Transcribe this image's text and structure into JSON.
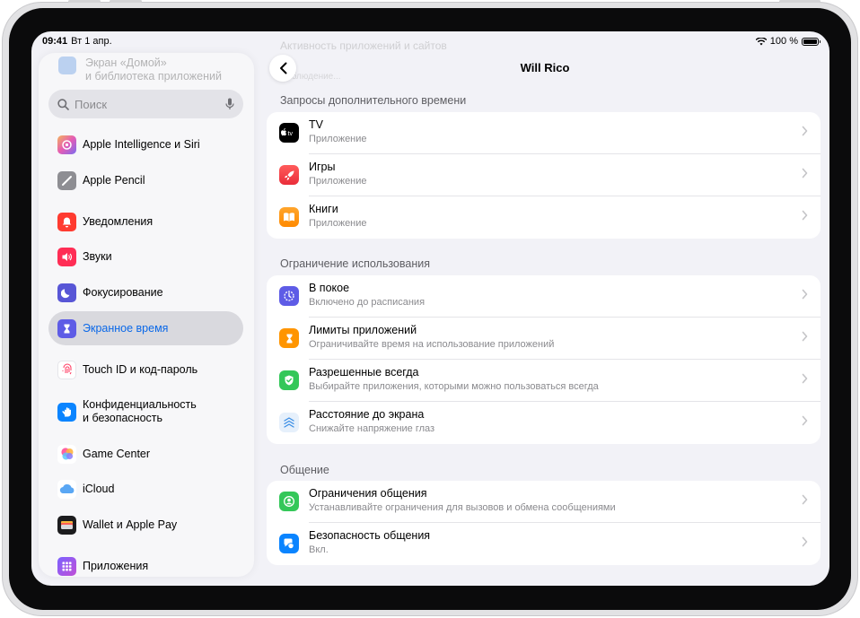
{
  "status_bar": {
    "time": "09:41",
    "date": "Вт 1 апр.",
    "battery": "100 %"
  },
  "sidebar": {
    "faded_item": "Экран «Домой»\nи библиотека приложений",
    "search_placeholder": "Поиск",
    "items": [
      {
        "label": "Apple Intelligence и Siri",
        "icon": "apple-intelligence-icon",
        "color": "#f0a85e"
      },
      {
        "label": "Apple Pencil",
        "icon": "apple-pencil-icon",
        "color": "#8e8e93"
      },
      {
        "label": "Уведомления",
        "icon": "bell-icon",
        "color": "#ff3b30"
      },
      {
        "label": "Звуки",
        "icon": "speaker-icon",
        "color": "#ff2d55"
      },
      {
        "label": "Фокусирование",
        "icon": "moon-icon",
        "color": "#5856d6"
      },
      {
        "label": "Экранное время",
        "icon": "hourglass-icon",
        "color": "#5e5ce6"
      },
      {
        "label": "Touch ID и код-пароль",
        "icon": "fingerprint-icon",
        "color": "#ffffff"
      },
      {
        "label": "Конфиденциальность\nи безопасность",
        "icon": "hand-icon",
        "color": "#0a84ff"
      },
      {
        "label": "Game Center",
        "icon": "game-center-icon",
        "color": "#ffffff"
      },
      {
        "label": "iCloud",
        "icon": "cloud-icon",
        "color": "#ffffff"
      },
      {
        "label": "Wallet и Apple Pay",
        "icon": "wallet-icon",
        "color": "#1c1c1e"
      },
      {
        "label": "Приложения",
        "icon": "apps-grid-icon",
        "color": "#5e5ce6"
      }
    ],
    "active_index": 5
  },
  "main": {
    "ghost_title": "Активность приложений и сайтов",
    "ghost_sub": "Наблюдение...",
    "nav_title": "Will Rico",
    "sections": [
      {
        "header": "Запросы дополнительного времени",
        "rows": [
          {
            "title": "TV",
            "subtitle": "Приложение",
            "icon": "apple-tv-icon",
            "color": "#000000"
          },
          {
            "title": "Игры",
            "subtitle": "Приложение",
            "icon": "games-rocket-icon",
            "color": "#ff3b30"
          },
          {
            "title": "Книги",
            "subtitle": "Приложение",
            "icon": "books-icon",
            "color": "#ff9500"
          }
        ]
      },
      {
        "header": "Ограничение использования",
        "rows": [
          {
            "title": "В покое",
            "subtitle": "Включено до расписания",
            "icon": "downtime-icon",
            "color": "#5e5ce6"
          },
          {
            "title": "Лимиты приложений",
            "subtitle": "Ограничивайте время на использование приложений",
            "icon": "hourglass-icon",
            "color": "#ff9500"
          },
          {
            "title": "Разрешенные всегда",
            "subtitle": "Выбирайте приложения, которыми можно пользоваться всегда",
            "icon": "checkmark-shield-icon",
            "color": "#34c759"
          },
          {
            "title": "Расстояние до экрана",
            "subtitle": "Снижайте напряжение глаз",
            "icon": "screen-distance-icon",
            "color": "#e6f0fb"
          }
        ]
      },
      {
        "header": "Общение",
        "rows": [
          {
            "title": "Ограничения общения",
            "subtitle": "Устанавливайте ограничения для вызовов и обмена сообщениями",
            "icon": "person-circle-icon",
            "color": "#34c759"
          },
          {
            "title": "Безопасность общения",
            "subtitle": "Вкл.",
            "icon": "chat-safety-icon",
            "color": "#0a84ff"
          }
        ]
      }
    ]
  }
}
